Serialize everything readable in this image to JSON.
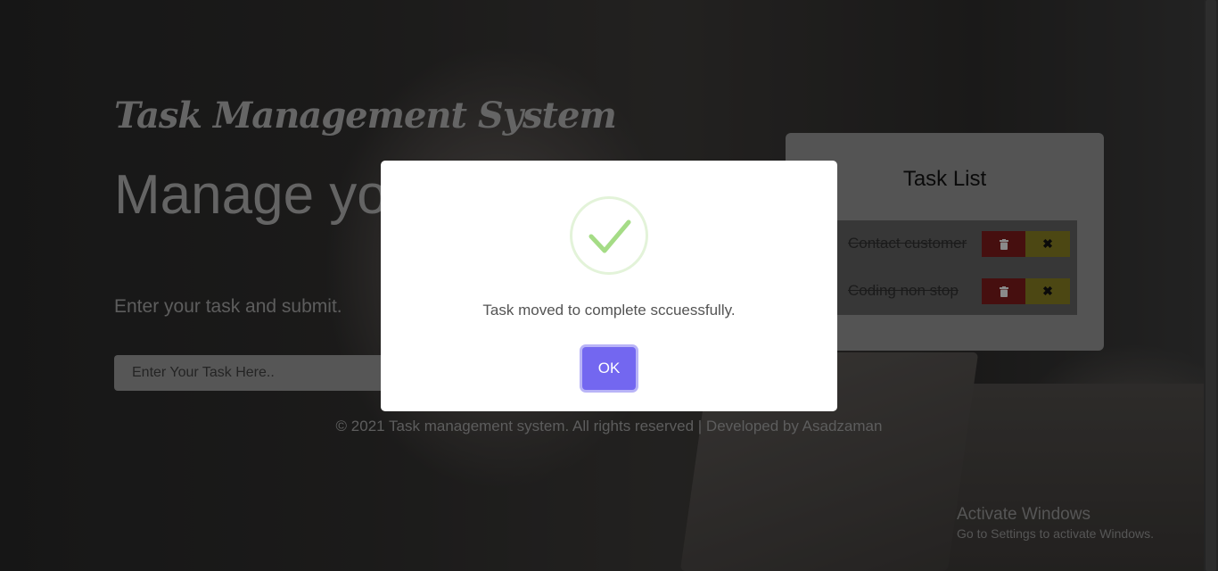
{
  "header": {
    "brand": "Task Management System"
  },
  "hero": {
    "heading": "Manage your task.",
    "subtitle": "Enter your task and submit."
  },
  "task_input": {
    "placeholder": "Enter Your Task Here..",
    "value": ""
  },
  "task_panel": {
    "title": "Task List",
    "tasks": [
      {
        "label": "Contact customer",
        "completed": true
      },
      {
        "label": "Coding non stop",
        "completed": true
      }
    ],
    "icons": {
      "delete": "trash-icon",
      "close": "close-icon"
    },
    "colors": {
      "delete": "#761a1a",
      "close": "#7f7720"
    }
  },
  "footer": {
    "text": "© 2021 Task management system. All rights reserved | Developed by Asadzaman"
  },
  "modal": {
    "icon": "success-checkmark-icon",
    "message": "Task moved to complete sccuessfully.",
    "ok_label": "OK",
    "colors": {
      "button": "#7367f0",
      "check": "#a5dc86"
    }
  },
  "watermark": {
    "title": "Activate Windows",
    "subtitle": "Go to Settings to activate Windows."
  }
}
